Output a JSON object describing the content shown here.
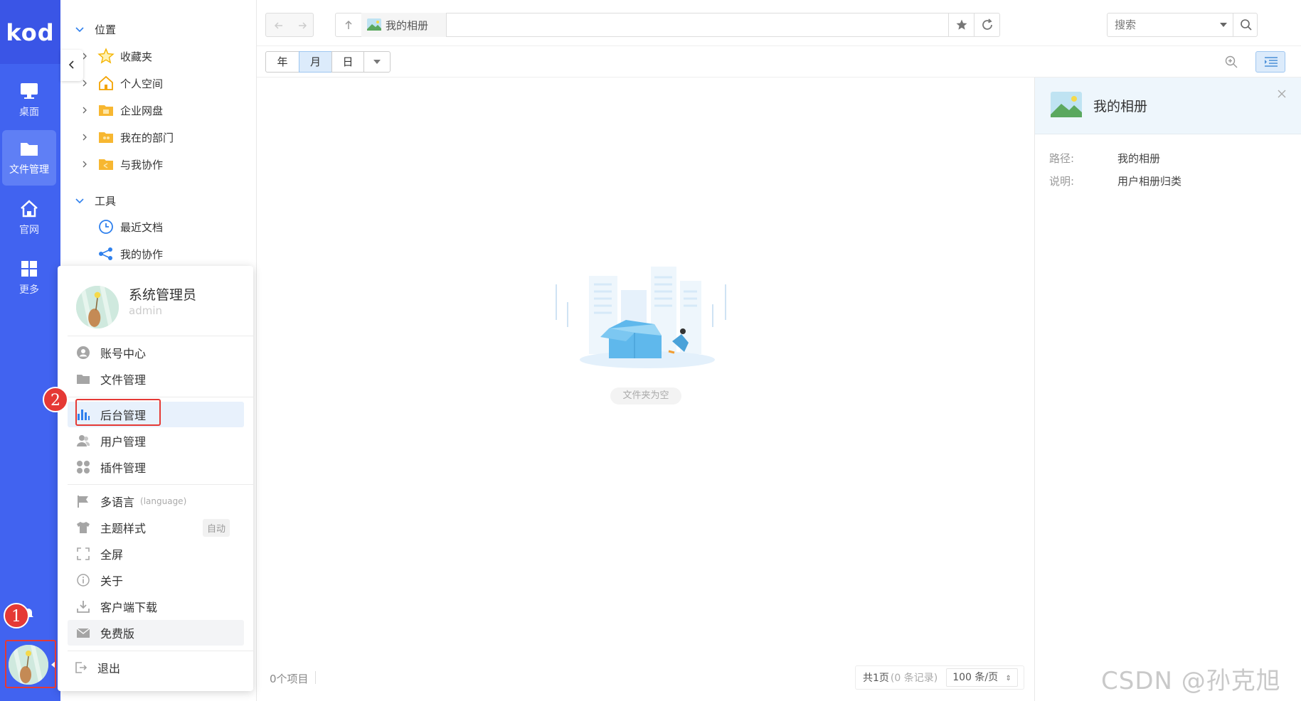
{
  "rail": {
    "logo": "kod",
    "items": [
      {
        "label": "桌面",
        "icon": "monitor-icon"
      },
      {
        "label": "文件管理",
        "icon": "folder-icon",
        "active": true
      },
      {
        "label": "官网",
        "icon": "home-icon"
      },
      {
        "label": "更多",
        "icon": "grid-icon"
      }
    ]
  },
  "sidebar": {
    "section_location": "位置",
    "location_items": [
      {
        "label": "收藏夹",
        "icon": "star-icon"
      },
      {
        "label": "个人空间",
        "icon": "house-icon"
      },
      {
        "label": "企业网盘",
        "icon": "enterprise-folder-icon"
      },
      {
        "label": "我在的部门",
        "icon": "department-folder-icon"
      },
      {
        "label": "与我协作",
        "icon": "share-folder-icon"
      }
    ],
    "section_tools": "工具",
    "tool_items": [
      {
        "label": "最近文档",
        "icon": "clock-icon"
      },
      {
        "label": "我的协作",
        "icon": "share-icon"
      }
    ]
  },
  "user_menu": {
    "name": "系统管理员",
    "account": "admin",
    "items": {
      "account_center": "账号中心",
      "file_manage": "文件管理",
      "admin_manage": "后台管理",
      "user_manage": "用户管理",
      "plugin_manage": "插件管理",
      "language": "多语言",
      "language_sub": "(language)",
      "theme": "主题样式",
      "theme_tag": "自动",
      "fullscreen": "全屏",
      "about": "关于",
      "client_download": "客户端下载",
      "free_version": "免费版",
      "logout": "退出"
    }
  },
  "badges": {
    "one": "1",
    "two": "2"
  },
  "toolbar": {
    "breadcrumb": "我的相册",
    "search_placeholder": "搜索"
  },
  "viewbar": {
    "year": "年",
    "month": "月",
    "day": "日"
  },
  "content": {
    "empty": "文件夹为空"
  },
  "status": {
    "count": "0个项目",
    "pages": "共1页",
    "records": "(0 条记录)",
    "per_page": "100 条/页"
  },
  "info_panel": {
    "title": "我的相册",
    "path_label": "路径:",
    "path_value": "我的相册",
    "desc_label": "说明:",
    "desc_value": "用户相册归类"
  },
  "watermark": "CSDN @孙克旭",
  "colors": {
    "rail": "#4163f0",
    "accent": "#2f80ed",
    "badge": "#e53935"
  }
}
